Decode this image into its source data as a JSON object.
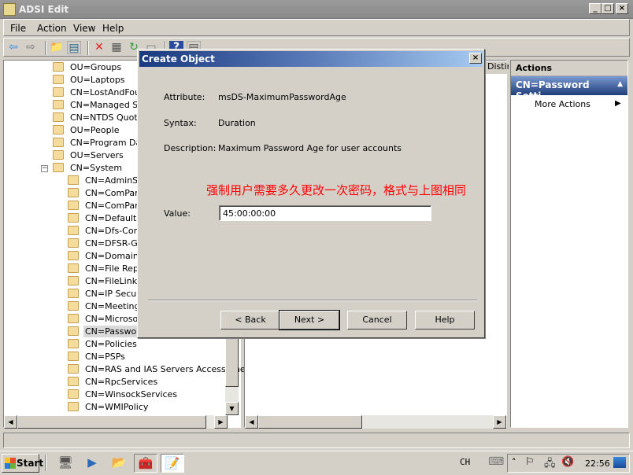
{
  "window": {
    "title": "ADSI Edit",
    "controls": {
      "minimize": "_",
      "maximize": "□",
      "close": "×"
    }
  },
  "menu": [
    "File",
    "Action",
    "View",
    "Help"
  ],
  "toolbar": {
    "icons": [
      "back-arrow-icon",
      "forward-arrow-icon",
      "up-folder-icon",
      "show-hide-tree-icon",
      "delete-icon",
      "properties-icon",
      "refresh-icon",
      "export-list-icon",
      "help-icon",
      "show-hide-action-pane-icon"
    ]
  },
  "tree": {
    "items": [
      {
        "label": "OU=Groups",
        "level": 1
      },
      {
        "label": "OU=Laptops",
        "level": 1
      },
      {
        "label": "CN=LostAndFound",
        "level": 1
      },
      {
        "label": "CN=Managed Serv",
        "level": 1
      },
      {
        "label": "CN=NTDS Quotas",
        "level": 1
      },
      {
        "label": "OU=People",
        "level": 1
      },
      {
        "label": "CN=Program Data",
        "level": 1
      },
      {
        "label": "OU=Servers",
        "level": 1
      },
      {
        "label": "CN=System",
        "level": 1,
        "expanded": true,
        "expander": "−"
      },
      {
        "label": "CN=AdminSDH",
        "level": 2
      },
      {
        "label": "CN=ComPartit",
        "level": 2
      },
      {
        "label": "CN=ComPartit",
        "level": 2
      },
      {
        "label": "CN=Default D",
        "level": 2
      },
      {
        "label": "CN=Dfs-Confi",
        "level": 2
      },
      {
        "label": "CN=DFSR-Glol",
        "level": 2
      },
      {
        "label": "CN=DomainUp",
        "level": 2
      },
      {
        "label": "CN=File Replic",
        "level": 2
      },
      {
        "label": "CN=FileLinks",
        "level": 2
      },
      {
        "label": "CN=IP Securit",
        "level": 2
      },
      {
        "label": "CN=Meetings",
        "level": 2
      },
      {
        "label": "CN=MicrosoftI",
        "level": 2
      },
      {
        "label": "CN=Password",
        "level": 2,
        "selected": true
      },
      {
        "label": "CN=Policies",
        "level": 2
      },
      {
        "label": "CN=PSPs",
        "level": 2
      },
      {
        "label": "CN=RAS and IAS Servers Access Che",
        "level": 2
      },
      {
        "label": "CN=RpcServices",
        "level": 2
      },
      {
        "label": "CN=WinsockServices",
        "level": 2
      },
      {
        "label": "CN=WMIPolicy",
        "level": 2
      }
    ]
  },
  "list": {
    "column_header": "Distin"
  },
  "actions": {
    "header": "Actions",
    "section": "CN=Password Setti...",
    "section_collapse": "▲",
    "items": [
      {
        "label": "More Actions",
        "arrow": "▶"
      }
    ]
  },
  "dialog": {
    "title": "Create Object",
    "close": "×",
    "attribute_label": "Attribute:",
    "attribute_value": "msDS-MaximumPasswordAge",
    "syntax_label": "Syntax:",
    "syntax_value": "Duration",
    "description_label": "Description:",
    "description_value": "Maximum Password Age for user accounts",
    "annotation": "强制用户需要多久更改一次密码，格式与上图相同",
    "value_label": "Value:",
    "value": "45:00:00:00",
    "buttons": {
      "back": "< Back",
      "next": "Next >",
      "cancel": "Cancel",
      "help": "Help"
    }
  },
  "taskbar": {
    "start": "Start",
    "apps": [
      "server-manager-icon",
      "powershell-icon",
      "explorer-icon",
      "toolbox-icon",
      "adsi-edit-icon"
    ],
    "language": "CH",
    "clock": "22:56",
    "tray_expand": "˄"
  },
  "colors": {
    "annotation": "#ff0000",
    "dialog_title_start": "#1a3a80",
    "actions_band": "#1e3c7a"
  }
}
